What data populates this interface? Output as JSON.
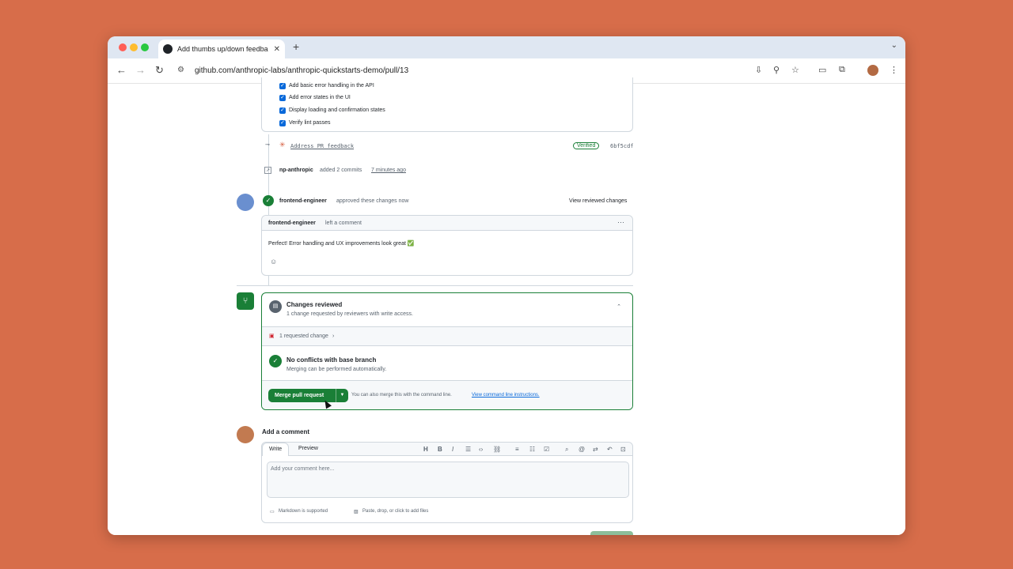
{
  "browser": {
    "tab_title": "Add thumbs up/down feedba",
    "url": "github.com/anthropic-labs/anthropic-quickstarts-demo/pull/13"
  },
  "checklist": {
    "items": [
      {
        "label": "Add basic error handling in the API",
        "checked": true
      },
      {
        "label": "Add error states in the UI",
        "checked": true
      },
      {
        "label": "Display loading and confirmation states",
        "checked": true
      },
      {
        "label": "Verify lint passes",
        "checked": true
      }
    ]
  },
  "commit": {
    "message": "Address PR feedback",
    "verified_label": "Verified",
    "sha": "6bf5cdf"
  },
  "push_event": {
    "user": "np-anthropic",
    "action": "added 2 commits",
    "time": "7 minutes ago"
  },
  "review": {
    "user": "frontend-engineer",
    "action": "approved these changes now",
    "view_link": "View reviewed changes",
    "comment_header_user": "frontend-engineer",
    "comment_header_action": "left a comment",
    "comment_body": "Perfect! Error handling and UX improvements look great ✅"
  },
  "merge_box": {
    "changes_title": "Changes reviewed",
    "changes_subtitle": "1 change requested by reviewers with write access.",
    "requested_change": "1 requested change",
    "conflicts_title": "No conflicts with base branch",
    "conflicts_subtitle": "Merging can be performed automatically.",
    "merge_button": "Merge pull request",
    "cli_text": "You can also merge this with the command line.",
    "cli_link": "View command line instructions."
  },
  "add_comment": {
    "title": "Add a comment",
    "tab_write": "Write",
    "tab_preview": "Preview",
    "placeholder": "Add your comment here...",
    "markdown_note": "Markdown is supported",
    "attach_note": "Paste, drop, or click to add files"
  },
  "colors": {
    "background": "#d76d4a",
    "github_green": "#1a7f37",
    "link_blue": "#0969da"
  }
}
